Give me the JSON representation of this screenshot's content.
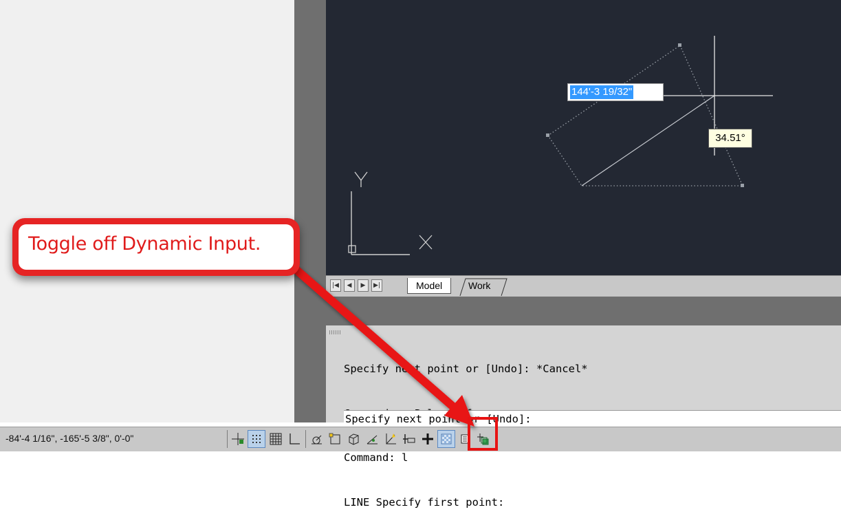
{
  "viewport": {
    "crosshair_length_input": "144'-3 19/32\"",
    "angle_tooltip": "34.51°",
    "ucs": {
      "y_label": "Y",
      "x_label": "X"
    }
  },
  "layout_tabs": {
    "nav_buttons": [
      "first",
      "previous",
      "next",
      "last"
    ],
    "tabs": [
      "Model",
      "Work"
    ],
    "active_tab": "Model"
  },
  "command_line": {
    "history": [
      "Specify next point or [Undo]: *Cancel*",
      "Command:  <Polar off>",
      "Command: l",
      "LINE Specify first point:"
    ],
    "prompt": "Specify next point or [Undo]:"
  },
  "status_bar": {
    "coordinates": "-84'-4 1/16\", -165'-5 3/8\", 0'-0\"",
    "buttons": [
      {
        "name": "infer-constraints-button",
        "icon": "infer-constraints-icon",
        "state": "off"
      },
      {
        "name": "snap-mode-button",
        "icon": "snap-icon",
        "state": "on"
      },
      {
        "name": "grid-display-button",
        "icon": "grid-icon",
        "state": "off"
      },
      {
        "name": "ortho-mode-button",
        "icon": "ortho-icon",
        "state": "off"
      },
      {
        "name": "polar-tracking-button",
        "icon": "polar-icon",
        "state": "off"
      },
      {
        "name": "object-snap-button",
        "icon": "osnap-icon",
        "state": "off"
      },
      {
        "name": "3d-object-snap-button",
        "icon": "3d-osnap-icon",
        "state": "off"
      },
      {
        "name": "object-snap-tracking-button",
        "icon": "otrack-icon",
        "state": "off"
      },
      {
        "name": "dynamic-ucs-button",
        "icon": "ducs-icon",
        "state": "off"
      },
      {
        "name": "dynamic-input-button",
        "icon": "dynamic-input-icon",
        "state": "off"
      },
      {
        "name": "lineweight-button",
        "icon": "lineweight-icon",
        "state": "off"
      },
      {
        "name": "transparency-button",
        "icon": "transparency-icon",
        "state": "on"
      },
      {
        "name": "quick-properties-button",
        "icon": "quick-properties-icon",
        "state": "off"
      },
      {
        "name": "selection-cycling-button",
        "icon": "selection-cycling-icon",
        "state": "off"
      }
    ]
  },
  "annotation": {
    "callout_text": "Toggle off Dynamic Input.",
    "color": "#e62424"
  },
  "colors": {
    "canvas_bg": "#232833",
    "highlight": "#3399ff",
    "tooltip_bg": "#ffffe1"
  }
}
